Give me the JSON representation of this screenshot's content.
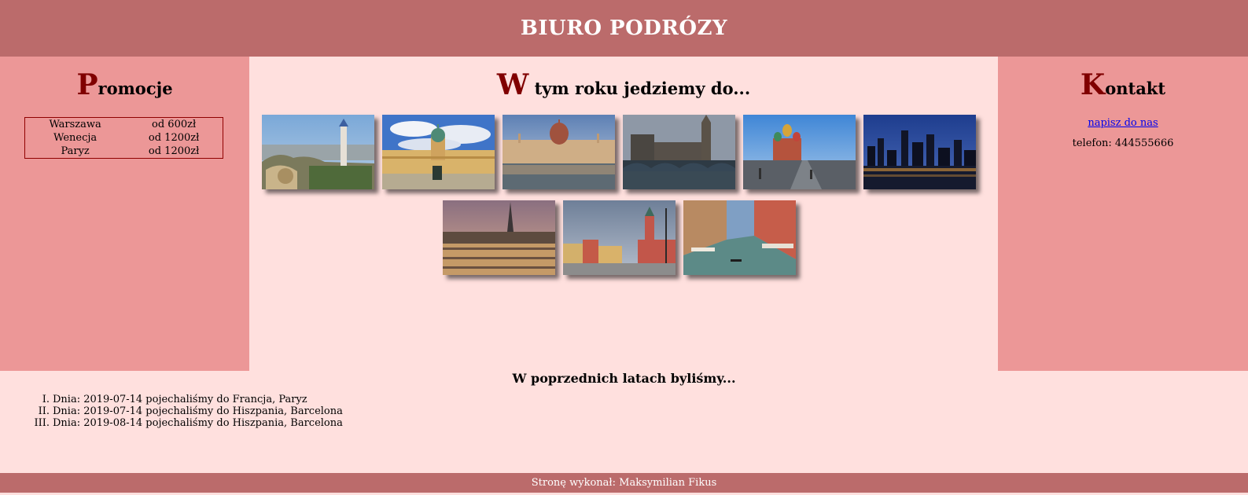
{
  "header": {
    "title": "BIURO PODRÓZY"
  },
  "left": {
    "heading_initial": "P",
    "heading_rest": "romocje",
    "promotions": [
      {
        "city": "Warszawa",
        "price": "od 600zł"
      },
      {
        "city": "Wenecja",
        "price": "od 1200zł"
      },
      {
        "city": "Paryz",
        "price": "od 1200zł"
      }
    ]
  },
  "center": {
    "heading_initial": "W",
    "heading_rest": " tym roku jedziemy do...",
    "photos": [
      {
        "name": "barcelona-park-guell-photo"
      },
      {
        "name": "berlin-charlottenburg-palace-photo"
      },
      {
        "name": "budapest-parliament-photo"
      },
      {
        "name": "london-westminster-photo"
      },
      {
        "name": "moscow-st-basils-photo"
      },
      {
        "name": "new-york-skyline-photo"
      },
      {
        "name": "paris-eiffel-tower-photo"
      },
      {
        "name": "warsaw-castle-square-photo"
      },
      {
        "name": "venice-grand-canal-photo"
      }
    ]
  },
  "right": {
    "heading_initial": "K",
    "heading_rest": "ontakt",
    "contact_link": "napisz do nas",
    "phone": "telefon: 444555666"
  },
  "history": {
    "heading": "W poprzednich latach byliśmy...",
    "items": [
      {
        "num": "I.",
        "text": "Dnia: 2019-07-14 pojechaliśmy do Francja, Paryz"
      },
      {
        "num": "II.",
        "text": "Dnia: 2019-07-14 pojechaliśmy do Hiszpania, Barcelona"
      },
      {
        "num": "III.",
        "text": "Dnia: 2019-08-14 pojechaliśmy do Hiszpania, Barcelona"
      }
    ]
  },
  "footer": {
    "text": "Stronę wykonał: Maksymilian Fikus"
  }
}
